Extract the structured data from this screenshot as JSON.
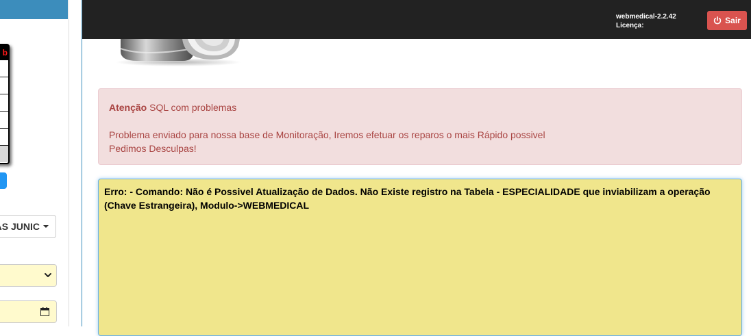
{
  "left_panel": {
    "table_header_fragment": "b",
    "user_dropdown_label": "AS JUNIC"
  },
  "topbar": {
    "version": "webmedical-2.2.42",
    "license_label": "Licença:",
    "logout_label": "Sair"
  },
  "alert": {
    "title_bold": "Atenção",
    "title_text": " SQL com problemas",
    "line1": "Problema enviado para nossa base de Monitoração, Iremos efetuar os reparos o mais Rápido possivel",
    "line2": "Pedimos Desculpas!"
  },
  "error": {
    "message": "Erro: - Comando: Não é Possivel Atualização de Dados. Não Existe registro na Tabela - ESPECIALIDADE que inviabilizam a operação (Chave Estrangeira), Modulo->WEBMEDICAL"
  },
  "colors": {
    "topbar": "#222222",
    "logout_button": "#d9534f",
    "alert_background": "#f2dede",
    "alert_text": "#a94442",
    "error_background": "#f0e68c",
    "left_accent": "#3c8dbc"
  },
  "icons": {
    "logout": "power-icon",
    "dropdown": "caret-down-icon",
    "select": "chevron-down-icon",
    "date": "calendar-icon"
  }
}
